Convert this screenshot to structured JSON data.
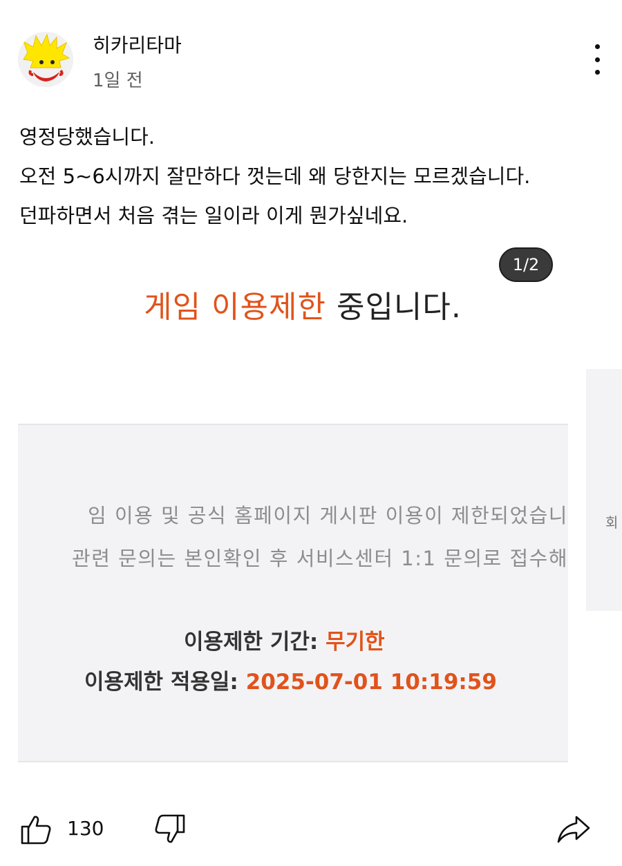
{
  "post": {
    "author": "히카리타마",
    "time": "1일 전",
    "lines": [
      "영정당했습니다.",
      "오전 5~6시까지 잘만하다 껏는데 왜 당한지는 모르겠습니다.",
      "던파하면서 처음 겪는 일이라 이게 뭔가싶네요."
    ],
    "avatar_icon": "cartoon-face-avatar"
  },
  "image_card": {
    "counter": "1/2",
    "headline_accent": "게임 이용제한",
    "headline_rest": " 중입니다.",
    "notice_line_1": "임 이용 및 공식 홈페이지 게시판 이용이 제한되었습니",
    "notice_line_2": "관련 문의는 본인확인 후 서비스센터 1:1 문의로 접수해",
    "period_label": "이용제한 기간: ",
    "period_value": "무기한",
    "applied_label": "이용제한 적용일: ",
    "applied_value": "2025-07-01 10:19:59",
    "next_peek_text": "회"
  },
  "actions": {
    "like_count": "130",
    "like_icon": "thumbs-up-icon",
    "dislike_icon": "thumbs-down-icon",
    "share_icon": "share-icon"
  },
  "colors": {
    "accent": "#e0531b",
    "counter_bg": "#3a3a3a",
    "notice_bg": "#f3f3f5"
  }
}
